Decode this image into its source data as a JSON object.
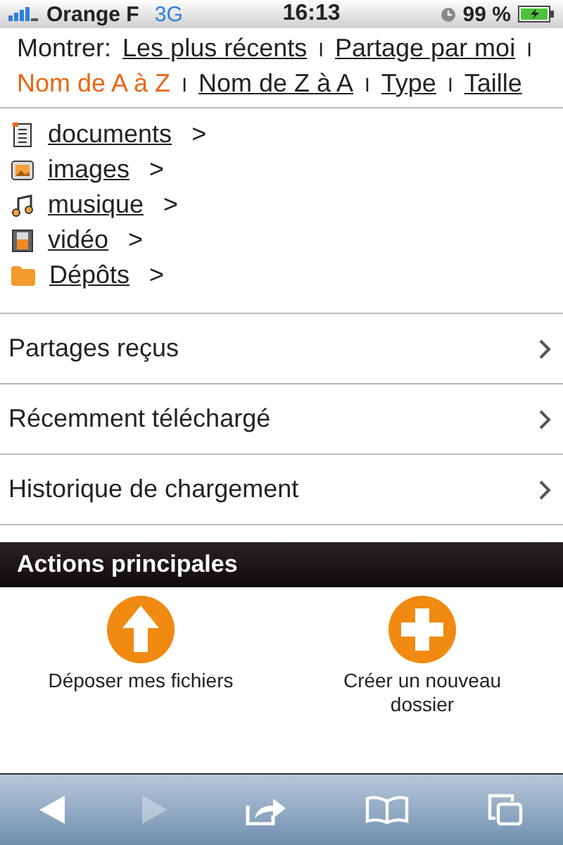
{
  "status_bar": {
    "carrier": "Orange F",
    "network": "3G",
    "time": "16:13",
    "battery": "99 %"
  },
  "sort": {
    "label": "Montrer:",
    "options": [
      {
        "label": "Les plus récents",
        "selected": false
      },
      {
        "separator": "I",
        "label": "Partage par moi",
        "selected": false
      },
      {
        "separator": "I",
        "label": "Nom de A à Z",
        "selected": true
      },
      {
        "separator": "I",
        "label": "Nom de Z à A",
        "selected": false
      },
      {
        "separator": "I",
        "label": "Type",
        "selected": false
      },
      {
        "separator": "I",
        "label": "Taille",
        "selected": false
      }
    ]
  },
  "folders": [
    {
      "kind": "document",
      "label": "documents",
      "arrow": ">"
    },
    {
      "kind": "image",
      "label": "images",
      "arrow": ">"
    },
    {
      "kind": "music",
      "label": "musique",
      "arrow": ">"
    },
    {
      "kind": "video",
      "label": "vidéo",
      "arrow": ">"
    },
    {
      "kind": "folder",
      "label": "Dépôts",
      "arrow": ">"
    }
  ],
  "menu": [
    {
      "label": "Partages reçus"
    },
    {
      "label": "Récemment téléchargé"
    },
    {
      "label": "Historique de chargement"
    }
  ],
  "actions": {
    "title": "Actions principales",
    "items": [
      {
        "kind": "upload",
        "label": "Déposer mes fichiers"
      },
      {
        "kind": "create",
        "label": "Créer un nouveau dossier"
      }
    ]
  },
  "toolbar": [
    {
      "kind": "back",
      "disabled": false
    },
    {
      "kind": "forward",
      "disabled": true
    },
    {
      "kind": "share",
      "disabled": false
    },
    {
      "kind": "bookmarks",
      "disabled": false
    },
    {
      "kind": "tabs",
      "disabled": false
    }
  ]
}
